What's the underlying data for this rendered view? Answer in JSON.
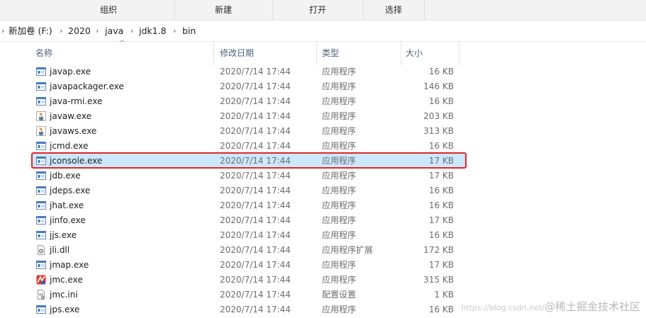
{
  "ribbon": {
    "groups": [
      "组织",
      "新建",
      "打开",
      "选择"
    ]
  },
  "breadcrumb": [
    "新加卷 (F:)",
    "2020",
    "java",
    "jdk1.8",
    "bin"
  ],
  "columns": {
    "name": "名称",
    "date": "修改日期",
    "type": "类型",
    "size": "大小"
  },
  "files": [
    {
      "name": "javap.exe",
      "date": "2020/7/14 17:44",
      "type": "应用程序",
      "size": "16 KB",
      "icon": "exe-window-icon"
    },
    {
      "name": "javapackager.exe",
      "date": "2020/7/14 17:44",
      "type": "应用程序",
      "size": "146 KB",
      "icon": "exe-window-icon"
    },
    {
      "name": "java-rmi.exe",
      "date": "2020/7/14 17:44",
      "type": "应用程序",
      "size": "16 KB",
      "icon": "exe-window-icon"
    },
    {
      "name": "javaw.exe",
      "date": "2020/7/14 17:44",
      "type": "应用程序",
      "size": "203 KB",
      "icon": "java-cup-icon"
    },
    {
      "name": "javaws.exe",
      "date": "2020/7/14 17:44",
      "type": "应用程序",
      "size": "313 KB",
      "icon": "java-cup-icon"
    },
    {
      "name": "jcmd.exe",
      "date": "2020/7/14 17:44",
      "type": "应用程序",
      "size": "16 KB",
      "icon": "exe-window-icon"
    },
    {
      "name": "jconsole.exe",
      "date": "2020/7/14 17:44",
      "type": "应用程序",
      "size": "17 KB",
      "icon": "exe-window-icon",
      "selected": true
    },
    {
      "name": "jdb.exe",
      "date": "2020/7/14 17:44",
      "type": "应用程序",
      "size": "17 KB",
      "icon": "exe-window-icon"
    },
    {
      "name": "jdeps.exe",
      "date": "2020/7/14 17:44",
      "type": "应用程序",
      "size": "16 KB",
      "icon": "exe-window-icon"
    },
    {
      "name": "jhat.exe",
      "date": "2020/7/14 17:44",
      "type": "应用程序",
      "size": "16 KB",
      "icon": "exe-window-icon"
    },
    {
      "name": "jinfo.exe",
      "date": "2020/7/14 17:44",
      "type": "应用程序",
      "size": "17 KB",
      "icon": "exe-window-icon"
    },
    {
      "name": "jjs.exe",
      "date": "2020/7/14 17:44",
      "type": "应用程序",
      "size": "16 KB",
      "icon": "exe-window-icon"
    },
    {
      "name": "jli.dll",
      "date": "2020/7/14 17:44",
      "type": "应用程序扩展",
      "size": "172 KB",
      "icon": "dll-gear-icon"
    },
    {
      "name": "jmap.exe",
      "date": "2020/7/14 17:44",
      "type": "应用程序",
      "size": "17 KB",
      "icon": "exe-window-icon"
    },
    {
      "name": "jmc.exe",
      "date": "2020/7/14 17:44",
      "type": "应用程序",
      "size": "315 KB",
      "icon": "jmc-app-icon"
    },
    {
      "name": "jmc.ini",
      "date": "2020/7/14 17:44",
      "type": "配置设置",
      "size": "1 KB",
      "icon": "ini-settings-icon"
    },
    {
      "name": "jps.exe",
      "date": "2020/7/14 17:44",
      "type": "应用程序",
      "size": "16 KB",
      "icon": "exe-window-icon"
    }
  ],
  "watermark": {
    "brand": "@稀土掘金技术社区",
    "url": "https://blog.csdn.net/"
  },
  "colors": {
    "selected_bg": "#cce8ff",
    "highlight_border": "#e02525",
    "header_text": "#4c607a"
  }
}
